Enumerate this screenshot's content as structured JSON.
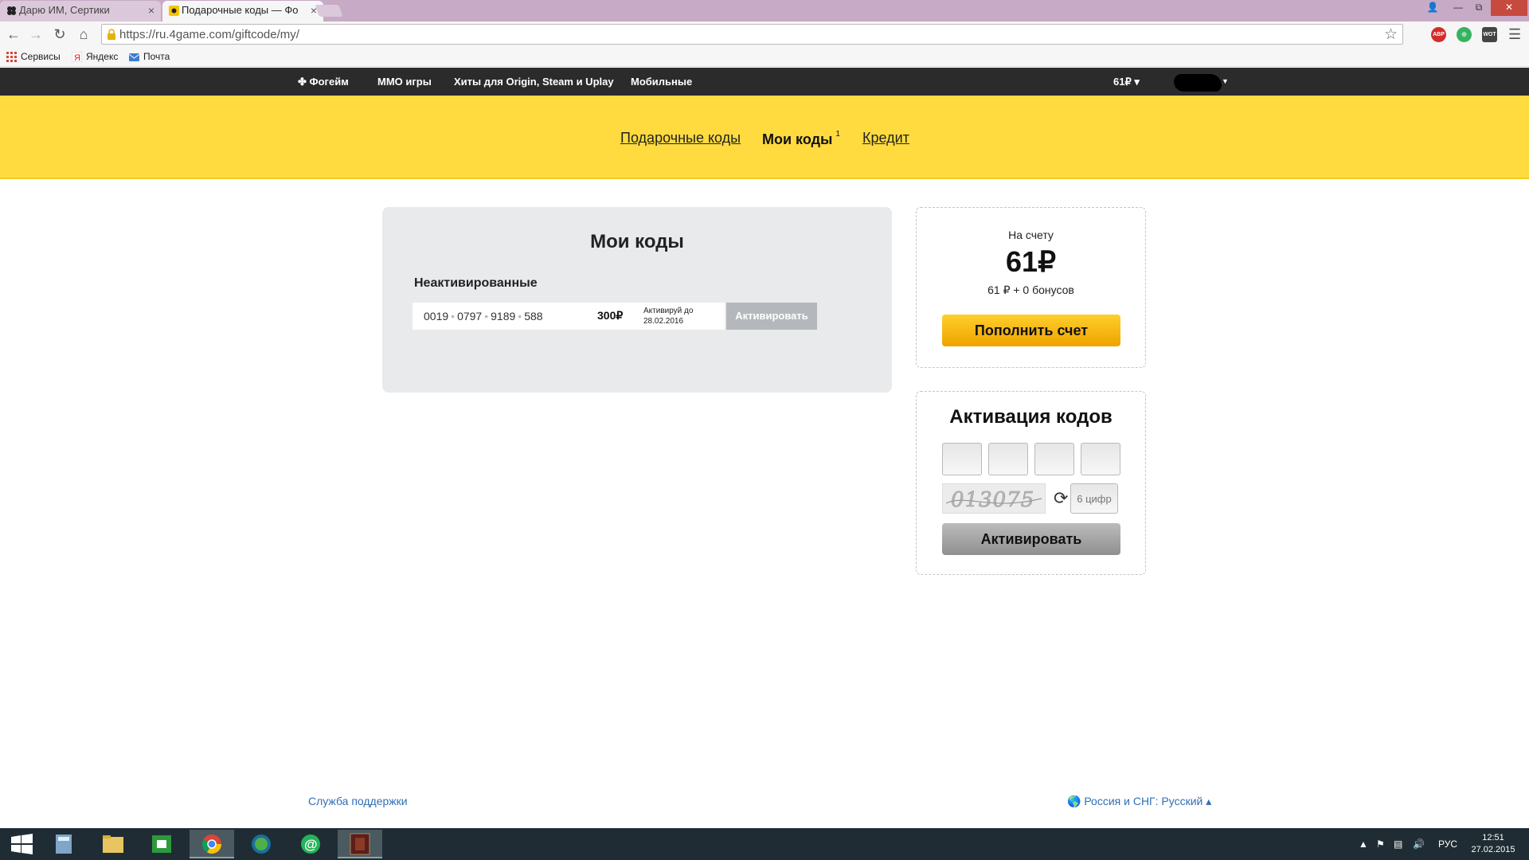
{
  "browser": {
    "tabs": [
      {
        "title": "Дарю ИМ, Сертики",
        "active": false
      },
      {
        "title": "Подарочные коды — Фо",
        "active": true
      }
    ],
    "url": "https://ru.4game.com/giftcode/my/",
    "bookmarks": [
      "Сервисы",
      "Яндекс",
      "Почта"
    ],
    "extensions": [
      "ABP",
      "WOT"
    ]
  },
  "site": {
    "nav": [
      "Фогейм",
      "ММО игры",
      "Хиты для Origin, Steam и Uplay",
      "Мобильные"
    ],
    "balance_menu": "61₽ ▾"
  },
  "subnav": {
    "items": [
      "Подарочные коды",
      "Мои коды",
      "Кредит"
    ],
    "badge": "1"
  },
  "my_codes": {
    "title": "Мои коды",
    "section": "Неактивированные",
    "code": {
      "parts": [
        "0019",
        "0797",
        "9189",
        "588"
      ],
      "amount": "300",
      "until_label": "Активируй до",
      "until_date": "28.02.2016",
      "button": "Активировать"
    }
  },
  "account": {
    "label": "На счету",
    "amount": "61",
    "detail": "61 ₽  + 0 бонусов",
    "topup_button": "Пополнить счет"
  },
  "activation": {
    "title": "Активация кодов",
    "captcha_text": "013075",
    "captcha_placeholder": "6 цифр",
    "button": "Активировать"
  },
  "footer": {
    "support": "Служба поддержки",
    "region": "Россия и СНГ: Русский ▴"
  },
  "taskbar": {
    "language": "РУС",
    "time": "12:51",
    "date": "27.02.2015"
  },
  "colors": {
    "header_yellow": "#ffdb3f",
    "topbar_dark": "#2b2b2b",
    "topup_orange": "#f4b400",
    "link_blue": "#2f6fb5"
  }
}
